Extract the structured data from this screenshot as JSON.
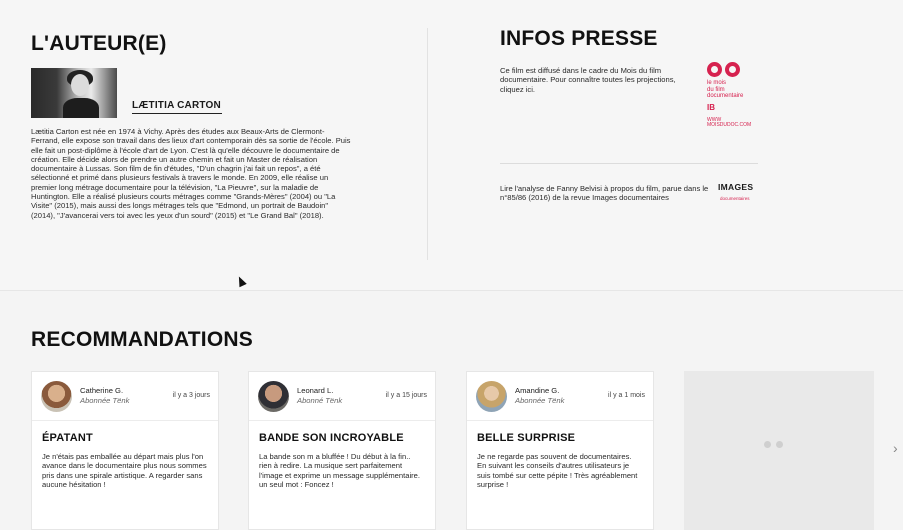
{
  "author": {
    "title": "L'AUTEUR(E)",
    "name": "LÆTITIA CARTON",
    "bio": "Lætitia Carton est née en 1974 à Vichy. Après des études aux Beaux-Arts de Clermont-Ferrand, elle expose son travail dans des lieux d'art contemporain dès sa sortie de l'école. Puis elle fait un post-diplôme à l'école d'art de Lyon. C'est là qu'elle découvre le documentaire de création. Elle décide alors de prendre un autre chemin et fait un Master de réalisation documentaire à Lussas. Son film de fin d'études, \"D'un chagrin j'ai fait un repos\", a été sélectionné et primé dans plusieurs festivals à travers le monde. En 2009, elle réalise un premier long métrage documentaire pour la télévision, \"La Pieuvre\", sur la maladie de Huntington. Elle a réalisé plusieurs courts métrages comme \"Grands-Mères\" (2004) ou \"La Visite\" (2015), mais aussi des longs métrages tels que \"Edmond, un portrait de Baudoin\" (2014), \"J'avancerai vers toi avec les yeux d'un sourd\" (2015) et \"Le Grand Bal\" (2018)."
  },
  "press": {
    "title": "INFOS PRESSE",
    "item1": "Ce film est diffusé dans le cadre du Mois du film documentaire. Pour connaître toutes les projections, cliquez ici.",
    "item2": "Lire l'analyse de Fanny Belvisi à propos du film, parue dans le n°85/86 (2016) de la revue Images documentaires",
    "logo_mdf": {
      "line1": "le mois",
      "line2": "du film",
      "line3": "documentaire",
      "ib": "IB",
      "www1": "WWW",
      "www2": "MOISDUDOC.COM"
    },
    "logo_images": {
      "main": "IMAGES",
      "sub": "documentaires"
    }
  },
  "recommendations": {
    "title": "RECOMMANDATIONS",
    "cards": [
      {
        "user": "Catherine G.",
        "role": "Abonnée Tënk",
        "time": "il y a 3 jours",
        "title": "ÉPATANT",
        "text": "Je n'étais pas emballée au départ mais plus l'on avance dans le documentaire plus nous sommes pris dans une spirale artistique. A regarder sans aucune hésitation !"
      },
      {
        "user": "Leonard L.",
        "role": "Abonné Tënk",
        "time": "il y a 15 jours",
        "title": "BANDE SON INCROYABLE",
        "text": "La bande son m a bluffée ! Du début à la fin.. rien à redire. La musique sert parfaitement l'image et exprime un message supplémentaire. un seul mot : Foncez !"
      },
      {
        "user": "Amandine G.",
        "role": "Abonnée Tënk",
        "time": "il y a 1 mois",
        "title": "BELLE SURPRISE",
        "text": "Je ne regarde pas souvent de documentaires. En suivant les conseils d'autres utilisateurs je suis tombé sur cette pépite ! Très agréablement surprise !"
      }
    ],
    "next_icon": "chevron-right-icon"
  },
  "colors": {
    "accent": "#d6224f",
    "background": "#f4f4f4"
  }
}
